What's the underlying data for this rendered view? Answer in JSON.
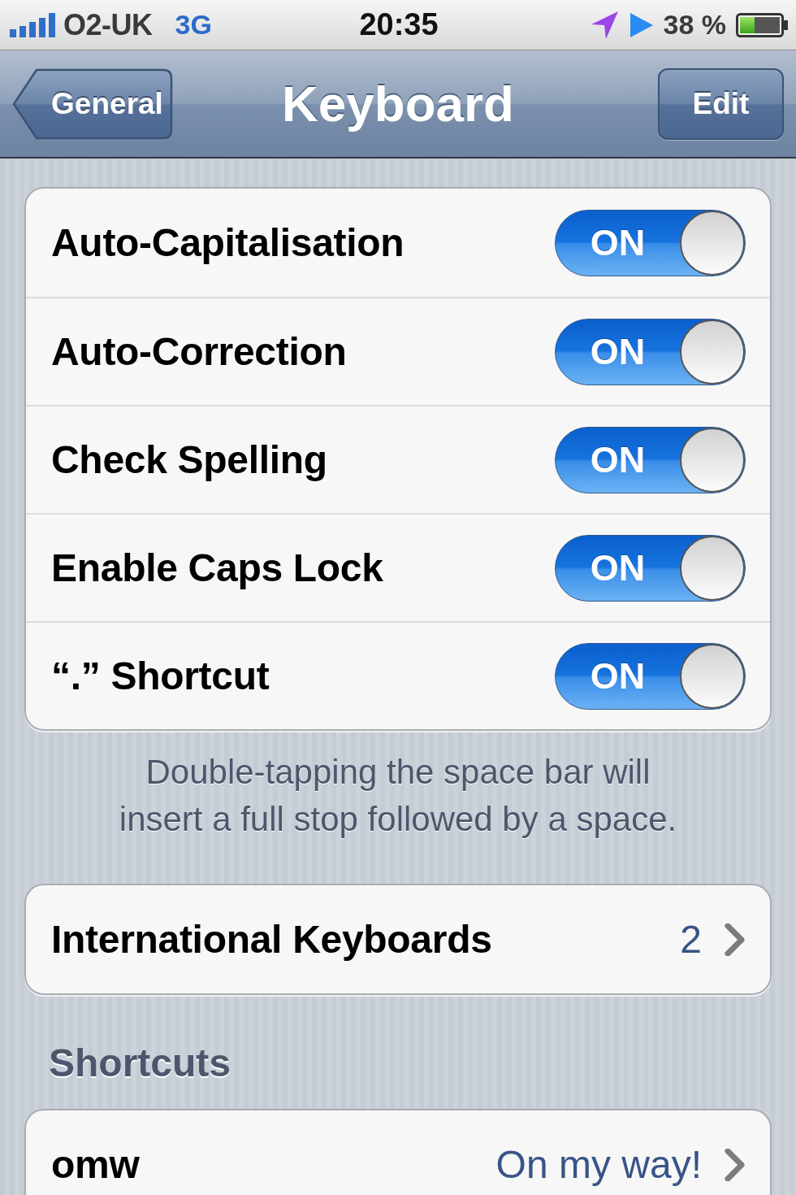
{
  "status_bar": {
    "carrier": "O2-UK",
    "network": "3G",
    "time": "20:35",
    "battery": "38 %"
  },
  "nav_bar": {
    "back_button": "General",
    "title": "Keyboard",
    "edit_button": "Edit"
  },
  "toggles": [
    {
      "label": "Auto-Capitalisation",
      "switch_text": "ON",
      "on": true
    },
    {
      "label": "Auto-Correction",
      "switch_text": "ON",
      "on": true
    },
    {
      "label": "Check Spelling",
      "switch_text": "ON",
      "on": true
    },
    {
      "label": "Enable Caps Lock",
      "switch_text": "ON",
      "on": true
    },
    {
      "label": "“.” Shortcut",
      "switch_text": "ON",
      "on": true
    }
  ],
  "toggles_footer": "Double-tapping the space bar will insert a full stop followed by a space.",
  "international_keyboards": {
    "label": "International Keyboards",
    "value": "2"
  },
  "shortcuts": {
    "header": "Shortcuts",
    "rows": [
      {
        "phrase": "omw",
        "expansion": "On my way!"
      }
    ]
  }
}
